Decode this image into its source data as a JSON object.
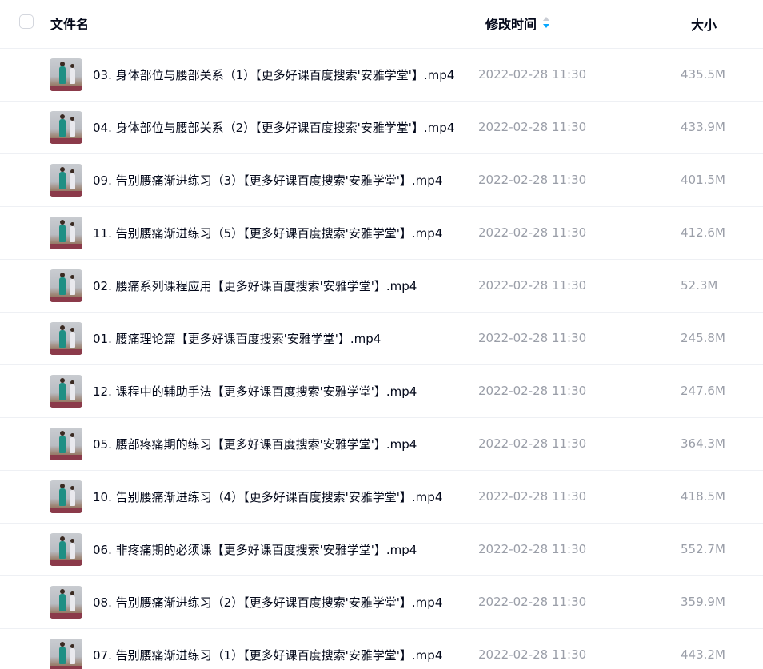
{
  "header": {
    "name_label": "文件名",
    "time_label": "修改时间",
    "size_label": "大小",
    "sort_icon": "sort-arrows-icon",
    "accent_color": "#06a7ff"
  },
  "files": [
    {
      "name": "03. 身体部位与腰部关系（1）【更多好课百度搜索'安雅学堂'】.mp4",
      "time": "2022-02-28 11:30",
      "size": "435.5M"
    },
    {
      "name": "04. 身体部位与腰部关系（2）【更多好课百度搜索'安雅学堂'】.mp4",
      "time": "2022-02-28 11:30",
      "size": "433.9M"
    },
    {
      "name": "09. 告别腰痛渐进练习（3）【更多好课百度搜索'安雅学堂'】.mp4",
      "time": "2022-02-28 11:30",
      "size": "401.5M"
    },
    {
      "name": "11. 告别腰痛渐进练习（5）【更多好课百度搜索'安雅学堂'】.mp4",
      "time": "2022-02-28 11:30",
      "size": "412.6M"
    },
    {
      "name": "02. 腰痛系列课程应用【更多好课百度搜索'安雅学堂'】.mp4",
      "time": "2022-02-28 11:30",
      "size": "52.3M"
    },
    {
      "name": "01. 腰痛理论篇【更多好课百度搜索'安雅学堂'】.mp4",
      "time": "2022-02-28 11:30",
      "size": "245.8M"
    },
    {
      "name": "12. 课程中的辅助手法【更多好课百度搜索'安雅学堂'】.mp4",
      "time": "2022-02-28 11:30",
      "size": "247.6M"
    },
    {
      "name": "05. 腰部疼痛期的练习【更多好课百度搜索'安雅学堂'】.mp4",
      "time": "2022-02-28 11:30",
      "size": "364.3M"
    },
    {
      "name": "10. 告别腰痛渐进练习（4）【更多好课百度搜索'安雅学堂'】.mp4",
      "time": "2022-02-28 11:30",
      "size": "418.5M"
    },
    {
      "name": "06. 非疼痛期的必须课【更多好课百度搜索'安雅学堂'】.mp4",
      "time": "2022-02-28 11:30",
      "size": "552.7M"
    },
    {
      "name": "08. 告别腰痛渐进练习（2）【更多好课百度搜索'安雅学堂'】.mp4",
      "time": "2022-02-28 11:30",
      "size": "359.9M"
    },
    {
      "name": "07. 告别腰痛渐进练习（1）【更多好课百度搜索'安雅学堂'】.mp4",
      "time": "2022-02-28 11:30",
      "size": "443.2M"
    }
  ]
}
